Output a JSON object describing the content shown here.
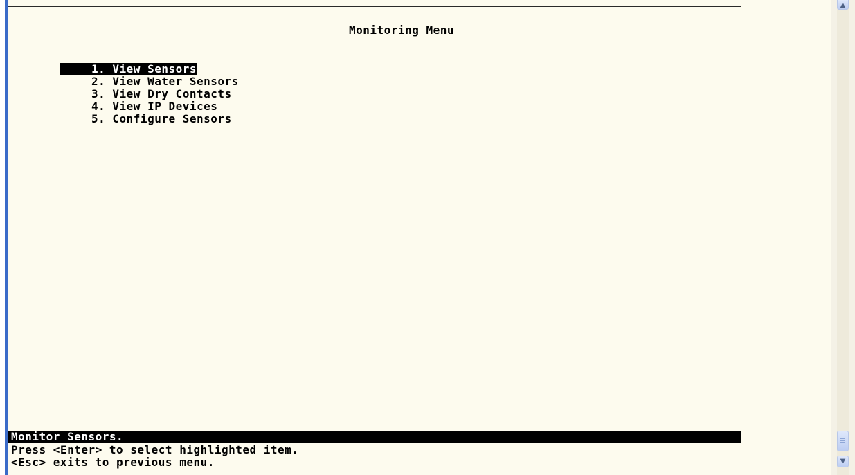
{
  "terminal": {
    "title": "Monitoring Menu",
    "menu_items": [
      {
        "label": "1. View Sensors",
        "selected": true
      },
      {
        "label": "2. View Water Sensors",
        "selected": false
      },
      {
        "label": "3. View Dry Contacts",
        "selected": false
      },
      {
        "label": "4. View IP Devices",
        "selected": false
      },
      {
        "label": "5. Configure Sensors",
        "selected": false
      }
    ],
    "status": "Monitor Sensors.",
    "help_lines": [
      "Press <Enter> to select highlighted item.",
      "<Esc> exits to previous menu."
    ]
  },
  "colors": {
    "background": "#fdfbee",
    "text": "#000000",
    "highlight_bg": "#000000",
    "highlight_text": "#ffffff",
    "window_border": "#3a6bc8"
  },
  "icons": {
    "scroll_up": "arrow-up-icon",
    "scroll_down": "chevron-down-icon"
  }
}
